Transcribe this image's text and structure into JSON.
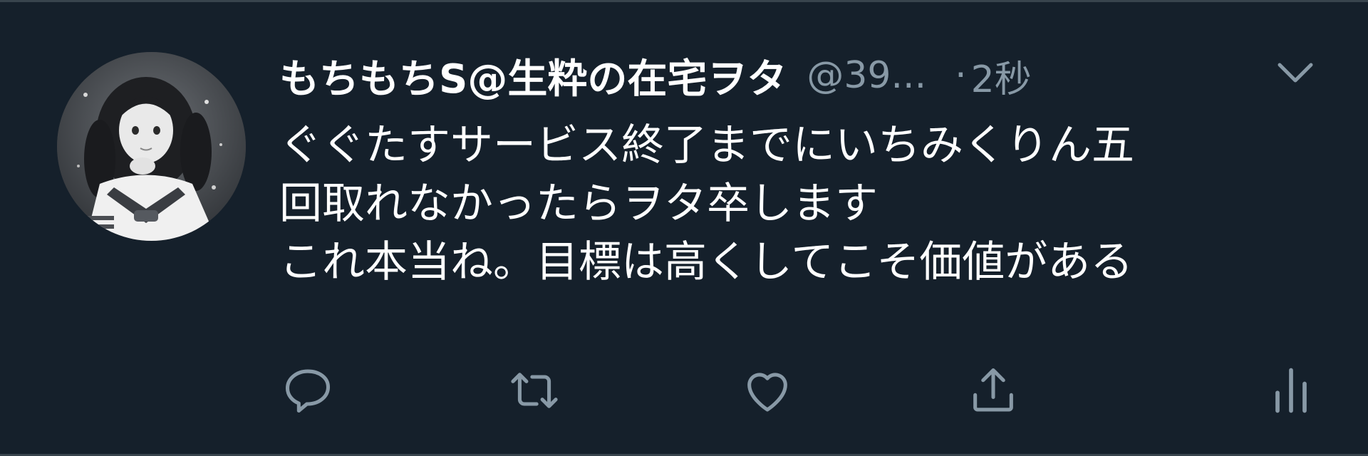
{
  "tweet": {
    "display_name": "もちもちS@生粋の在宅ヲタ",
    "handle": "@39...",
    "separator": "·",
    "time": "2秒",
    "text_lines": [
      "ぐぐたすサービス終了までにいちみくりん五",
      "回取れなかったらヲタ卒します",
      "これ本当ね。目標は高くしてこそ価値がある"
    ]
  },
  "icons": {
    "caret": "chevron-down-icon",
    "reply": "reply-icon",
    "retweet": "retweet-icon",
    "like": "heart-icon",
    "share": "share-icon",
    "analytics": "analytics-icon"
  },
  "colors": {
    "background": "#15202b",
    "primary_text": "#ffffff",
    "secondary_text": "#8899a6",
    "border": "#38444d"
  }
}
